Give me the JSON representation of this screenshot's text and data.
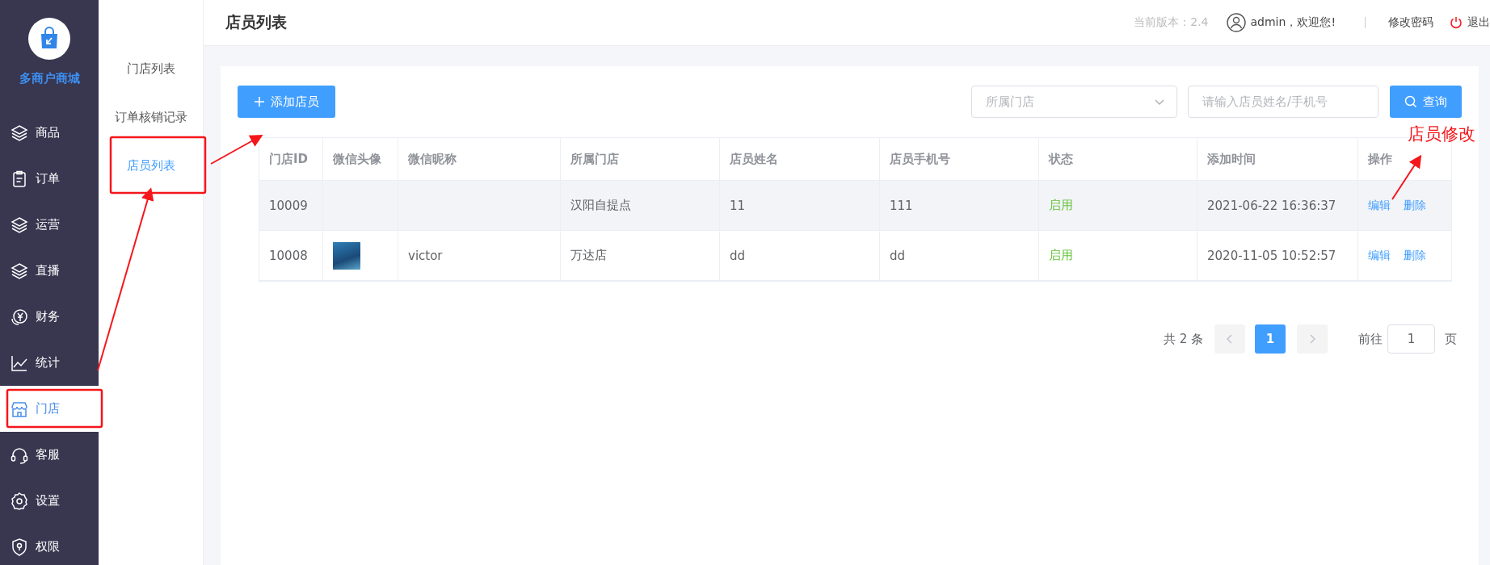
{
  "sidebar": {
    "brand": "多商户商城",
    "items": [
      {
        "label": "商品",
        "selected": false
      },
      {
        "label": "订单",
        "selected": false
      },
      {
        "label": "运营",
        "selected": false
      },
      {
        "label": "直播",
        "selected": false
      },
      {
        "label": "财务",
        "selected": false
      },
      {
        "label": "统计",
        "selected": false
      },
      {
        "label": "门店",
        "selected": true
      },
      {
        "label": "客服",
        "selected": false
      },
      {
        "label": "设置",
        "selected": false
      },
      {
        "label": "权限",
        "selected": false
      }
    ]
  },
  "submenu": [
    {
      "label": "门店列表",
      "selected": false
    },
    {
      "label": "订单核销记录",
      "selected": false
    },
    {
      "label": "店员列表",
      "selected": true
    }
  ],
  "header": {
    "title": "店员列表",
    "version": "当前版本：2.4",
    "user": "admin，欢迎您!",
    "change_password": "修改密码",
    "logout": "退出"
  },
  "toolbar": {
    "add_button": "添加店员",
    "store_select": {
      "placeholder": "所属门店"
    },
    "search": {
      "placeholder": "请输入店员姓名/手机号"
    },
    "query_button": "查询"
  },
  "table": {
    "columns": [
      "门店ID",
      "微信头像",
      "微信昵称",
      "所属门店",
      "店员姓名",
      "店员手机号",
      "状态",
      "添加时间",
      "操作"
    ],
    "rows": [
      {
        "store_id": "10009",
        "has_avatar": false,
        "store": "汉阳自提点",
        "name": "11",
        "phone": "111",
        "status": "启用",
        "status_on": true,
        "added": "2021-06-22 16:36:37",
        "actions": [
          "编辑",
          "删除"
        ],
        "highlighted": true
      },
      {
        "store_id": "10008",
        "has_avatar": true,
        "nickname": "victor",
        "store": "万达店",
        "name": "dd",
        "phone": "dd",
        "status": "启用",
        "status_on": true,
        "added": "2020-11-05 10:52:57",
        "actions": [
          "编辑",
          "删除"
        ],
        "highlighted": false
      }
    ]
  },
  "pagination": {
    "total": "共 2 条",
    "prev_disabled": true,
    "next_disabled": true,
    "pages": [
      {
        "label": "1",
        "selected": true
      }
    ],
    "goto_label": "前往",
    "goto_value": "1",
    "page_unit": "页"
  },
  "annotation": {
    "note": "店员修改"
  }
}
